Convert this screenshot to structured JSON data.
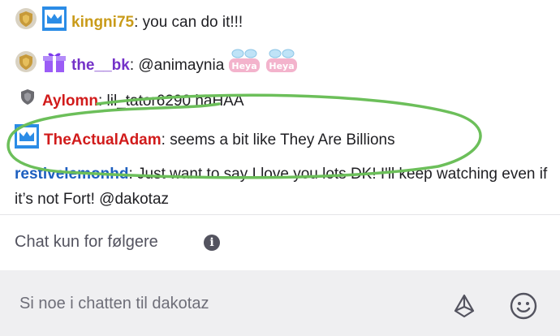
{
  "messages": [
    {
      "user": "kingni75",
      "separator": ":",
      "text": " you can do it!!!",
      "user_color": "#c99b19",
      "badges": [
        "shield-badge",
        "crown-badge"
      ],
      "emotes": []
    },
    {
      "user": "the__bk",
      "separator": ":",
      "text": " @animaynia",
      "user_color": "#7432c8",
      "badges": [
        "shield-badge",
        "gift-badge"
      ],
      "emotes": [
        "Heya",
        "Heya"
      ]
    },
    {
      "user": "Aylomn",
      "separator": ":",
      "text": " lil_tator6290 haHAA",
      "user_color": "#d11b1b",
      "badges": [
        "shield-badge"
      ],
      "emotes": []
    },
    {
      "user": "TheActualAdam",
      "separator": ":",
      "text": " seems a bit like They Are Billions",
      "user_color": "#d11b1b",
      "badges": [
        "crown-badge"
      ],
      "emotes": []
    },
    {
      "user": "restivelemonhd",
      "separator": ":",
      "text": " Just want to say I love you lots DK! I'll keep watching even if it’s not Fort! @dakotaz",
      "user_color": "#1d5fbf",
      "badges": [],
      "emotes": []
    }
  ],
  "follower_notice": "Chat kun for følgere",
  "input": {
    "placeholder": "Si noe i chatten til dakotaz"
  },
  "colors": {
    "crown_badge": "#2b8ce6",
    "gift_badge": "#9b5cf6",
    "shield_badge": "#c79a3a",
    "annotation": "#6cbf5a"
  },
  "icons": [
    "info-icon",
    "bits-icon",
    "emote-picker-icon"
  ]
}
